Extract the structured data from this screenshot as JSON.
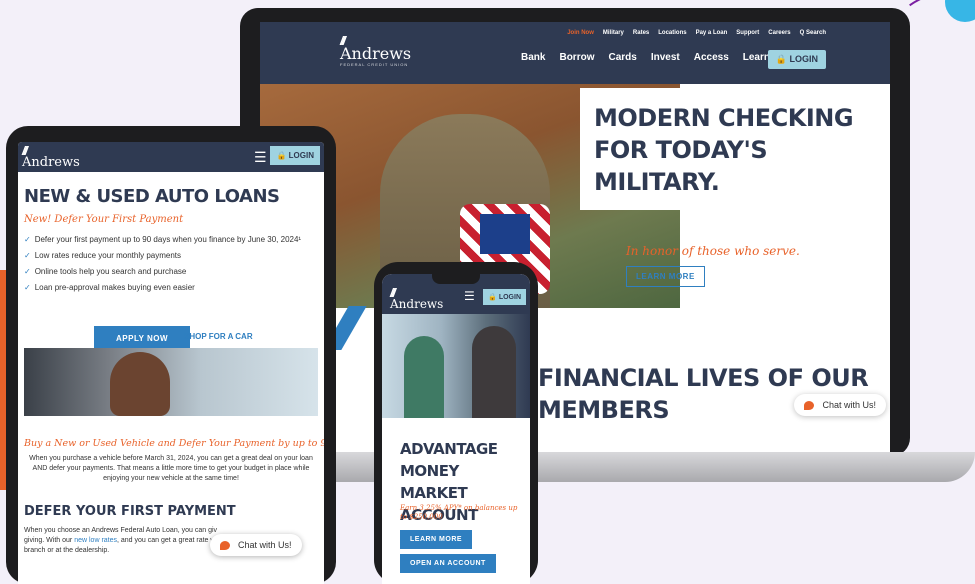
{
  "laptop": {
    "brand": "Andrews",
    "brand_sub": "FEDERAL CREDIT UNION",
    "top_nav": [
      "Join Now",
      "Military",
      "Rates",
      "Locations",
      "Pay a Loan",
      "Support",
      "Careers",
      "Q Search"
    ],
    "main_nav": [
      "Bank",
      "Borrow",
      "Cards",
      "Invest",
      "Access",
      "Learn"
    ],
    "login_label": "LOGIN",
    "headline": [
      "MODERN CHECKING",
      "FOR TODAY'S",
      "MILITARY."
    ],
    "honor_text": "In honor of those who serve.",
    "learn_more": "LEARN MORE",
    "financial": [
      "FINANCIAL LIVES OF OUR",
      "MEMBERS"
    ],
    "chat": "Chat with Us!"
  },
  "tablet": {
    "brand": "Andrews",
    "login_label": "LOGIN",
    "title": "NEW & USED AUTO LOANS",
    "subtitle": "New! Defer Your First Payment",
    "bullets": [
      "Defer your first payment up to 90 days when you finance by June 30, 2024¹",
      "Low rates reduce your monthly payments",
      "Online tools help you search and purchase",
      "Loan pre-approval makes buying even easier"
    ],
    "apply_now": "APPLY NOW",
    "shop_car": "SHOP FOR A CAR",
    "promo": "Buy a New or Used Vehicle and Defer Your Payment by up to 90 Days",
    "promo_body": "When you purchase a vehicle before March 31, 2024, you can get a great deal on your loan AND defer your payments. That means a little more time to get your budget in place while enjoying your new vehicle at the same time!",
    "defer_title": "DEFER YOUR FIRST PAYMENT",
    "defer_body_1": "When you choose an Andrews Federal Auto Loan, you can giv",
    "defer_body_2": "giving. With our",
    "defer_link": "new low rates",
    "defer_body_3": ", and you can get a great rate wh",
    "defer_body_4": "branch or at the dealership.",
    "chat": "Chat with Us!"
  },
  "phone": {
    "brand": "Andrews",
    "login_label": "LOGIN",
    "title": [
      "ADVANTAGE",
      "MONEY MARKET",
      "ACCOUNT"
    ],
    "rate": "Earn 3.25% APY* on balances up to $250,000",
    "learn_more": "LEARN MORE",
    "open_account": "OPEN AN ACCOUNT"
  },
  "colors": {
    "navy": "#2f3a52",
    "orange": "#e8622a",
    "blue": "#2f7fc0",
    "login_bg": "#9fd3e1"
  },
  "icons": [
    "menu-icon",
    "lock-icon",
    "check-icon",
    "chat-icon",
    "search-icon"
  ]
}
